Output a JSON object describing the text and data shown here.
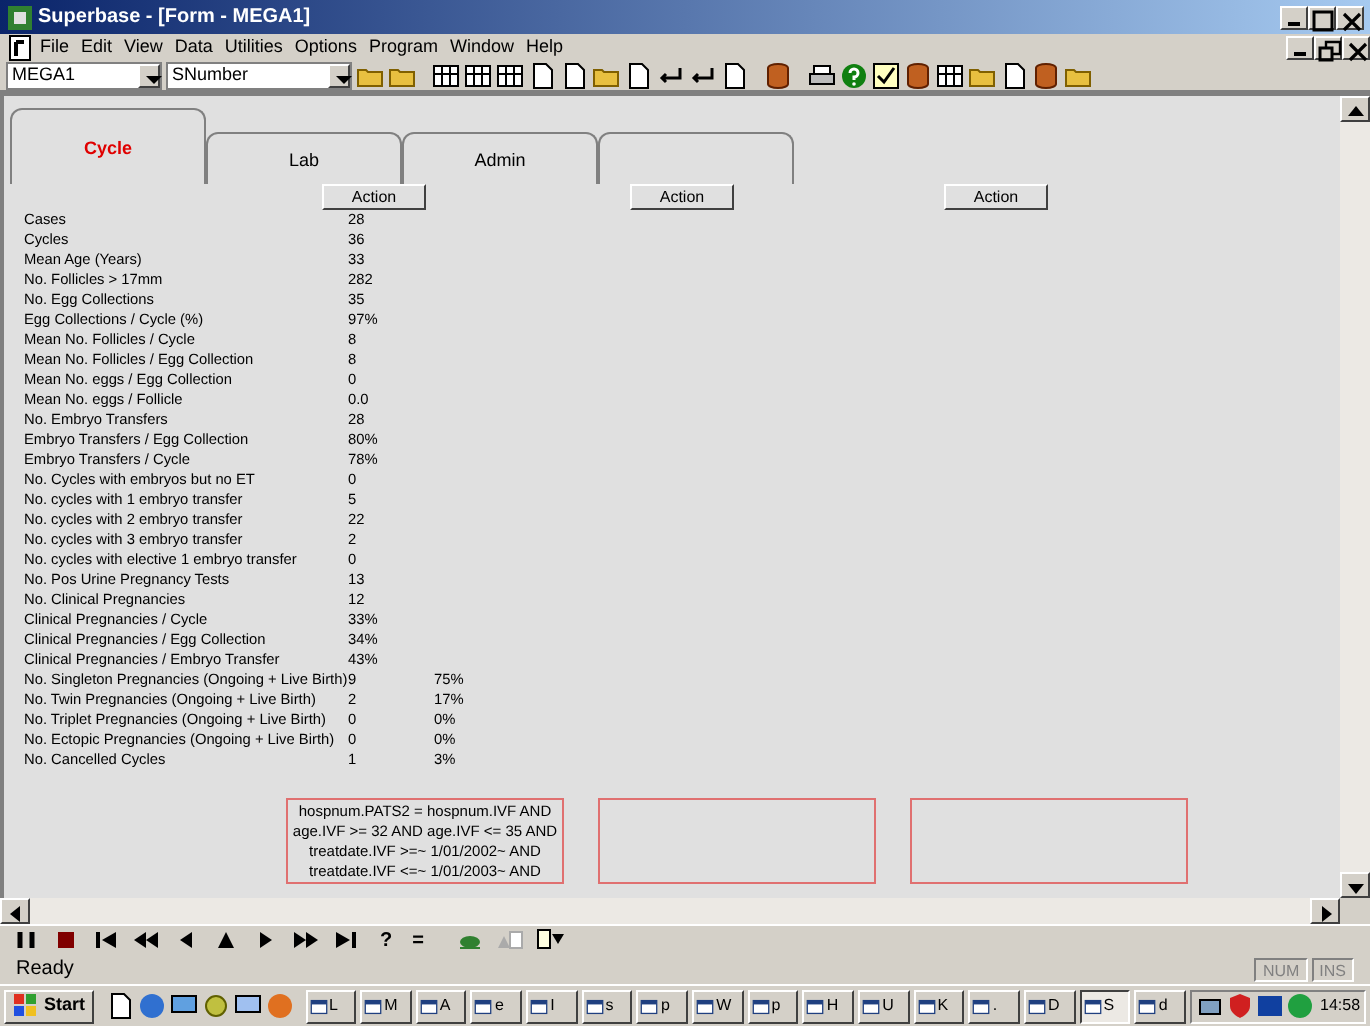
{
  "window": {
    "title": "Superbase - [Form - MEGA1]"
  },
  "menu": [
    "File",
    "Edit",
    "View",
    "Data",
    "Utilities",
    "Options",
    "Program",
    "Window",
    "Help"
  ],
  "toolbar": {
    "form_combo": "MEGA1",
    "field_combo": "SNumber"
  },
  "tabs": [
    {
      "label": "Cycle",
      "selected": true
    },
    {
      "label": "Lab",
      "selected": false
    },
    {
      "label": "Admin",
      "selected": false
    },
    {
      "selected": false
    }
  ],
  "action_buttons": [
    "Action",
    "Action",
    "Action"
  ],
  "stats": [
    {
      "label": "Cases",
      "value": "28"
    },
    {
      "label": "Cycles",
      "value": "36"
    },
    {
      "label": "Mean Age (Years)",
      "value": "33"
    },
    {
      "label": "No. Follicles > 17mm",
      "value": "282"
    },
    {
      "label": "No. Egg Collections",
      "value": "35"
    },
    {
      "label": "Egg Collections / Cycle (%)",
      "value": "97%"
    },
    {
      "label": "Mean No. Follicles / Cycle",
      "value": "8"
    },
    {
      "label": "Mean No. Follicles / Egg Collection",
      "value": "8"
    },
    {
      "label": "Mean No. eggs / Egg Collection",
      "value": "0"
    },
    {
      "label": "Mean No. eggs / Follicle",
      "value": "0.0"
    },
    {
      "label": "No. Embryo Transfers",
      "value": "28"
    },
    {
      "label": "Embryo Transfers / Egg Collection",
      "value": "80%"
    },
    {
      "label": "Embryo Transfers / Cycle",
      "value": "78%"
    },
    {
      "label": "No. Cycles with embryos but no ET",
      "value": "0"
    },
    {
      "label": "No. cycles with 1 embryo transfer",
      "value": "5"
    },
    {
      "label": "No. cycles with 2 embryo transfer",
      "value": "22"
    },
    {
      "label": "No. cycles with 3 embryo transfer",
      "value": "2"
    },
    {
      "label": "No. cycles with elective 1 embryo transfer",
      "value": "0"
    },
    {
      "label": "No. Pos Urine Pregnancy Tests",
      "value": "13"
    },
    {
      "label": "No. Clinical Pregnancies",
      "value": "12"
    },
    {
      "label": "Clinical Pregnancies / Cycle",
      "value": "33%"
    },
    {
      "label": "Clinical Pregnancies / Egg Collection",
      "value": "34%"
    },
    {
      "label": "Clinical Pregnancies / Embryo Transfer",
      "value": "43%"
    },
    {
      "label": "No. Singleton Pregnancies (Ongoing + Live Birth)",
      "value": "9",
      "percent": "75%"
    },
    {
      "label": "No. Twin Pregnancies (Ongoing + Live Birth)",
      "value": "2",
      "percent": "17%"
    },
    {
      "label": "No. Triplet Pregnancies (Ongoing + Live Birth)",
      "value": "0",
      "percent": "0%"
    },
    {
      "label": "No. Ectopic Pregnancies (Ongoing + Live Birth)",
      "value": "0",
      "percent": "0%"
    },
    {
      "label": "No. Cancelled Cycles",
      "value": "1",
      "percent": "3%"
    }
  ],
  "criteria_boxes": [
    {
      "kind": "query",
      "text": "hospnum.PATS2 = hospnum.IVF AND\nage.IVF >= 32 AND age.IVF <= 35 AND\ntreatdate.IVF >=~ 1/01/2002~ AND\ntreatdate.IVF <=~ 1/01/2003~ AND"
    },
    {
      "kind": "blank"
    },
    {
      "kind": "blank"
    }
  ],
  "record_toolbar": {
    "query_symbol": "?",
    "equals_symbol": "="
  },
  "status_bar": {
    "message": "Ready",
    "indicators": [
      "NUM",
      "INS"
    ]
  },
  "taskbar": {
    "start": "Start",
    "buttons": [
      "L",
      "M",
      "A",
      "e",
      "I",
      "s",
      "p",
      "W",
      "p",
      "H",
      "U",
      "K",
      ".",
      "D",
      "S",
      "d"
    ],
    "clock": "14:58"
  }
}
